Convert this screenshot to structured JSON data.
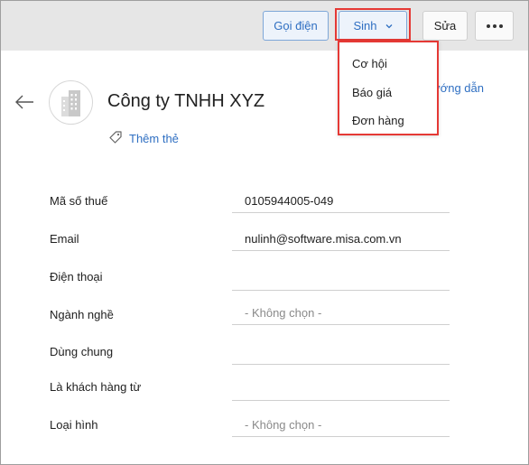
{
  "toolbar": {
    "call_label": "Gọi điện",
    "generate_label": "Sinh",
    "edit_label": "Sửa"
  },
  "generate_menu": {
    "items": [
      "Cơ hội",
      "Báo giá",
      "Đơn hàng"
    ]
  },
  "guide_link": "ướng dẫn",
  "header": {
    "company_name": "Công ty TNHH XYZ",
    "add_tag_label": "Thêm thẻ"
  },
  "fields": [
    {
      "label": "Mã số thuế",
      "value": "0105944005-049"
    },
    {
      "label": "Email",
      "value": "nulinh@software.misa.com.vn"
    },
    {
      "label": "Điện thoại",
      "value": ""
    },
    {
      "label": "Ngành nghề",
      "value": "- Không chọn -"
    },
    {
      "label": "Dùng chung",
      "value": ""
    },
    {
      "label": "Là khách hàng từ",
      "value": ""
    },
    {
      "label": "Loại hình",
      "value": "- Không chọn -"
    }
  ],
  "colors": {
    "accent_blue": "#2f6fc2",
    "highlight_red": "#e53935",
    "toolbar_bg": "#e6e6e6"
  },
  "icons": [
    "back-arrow-icon",
    "building-icon",
    "tag-icon",
    "chevron-down-icon",
    "more-dots-icon"
  ]
}
